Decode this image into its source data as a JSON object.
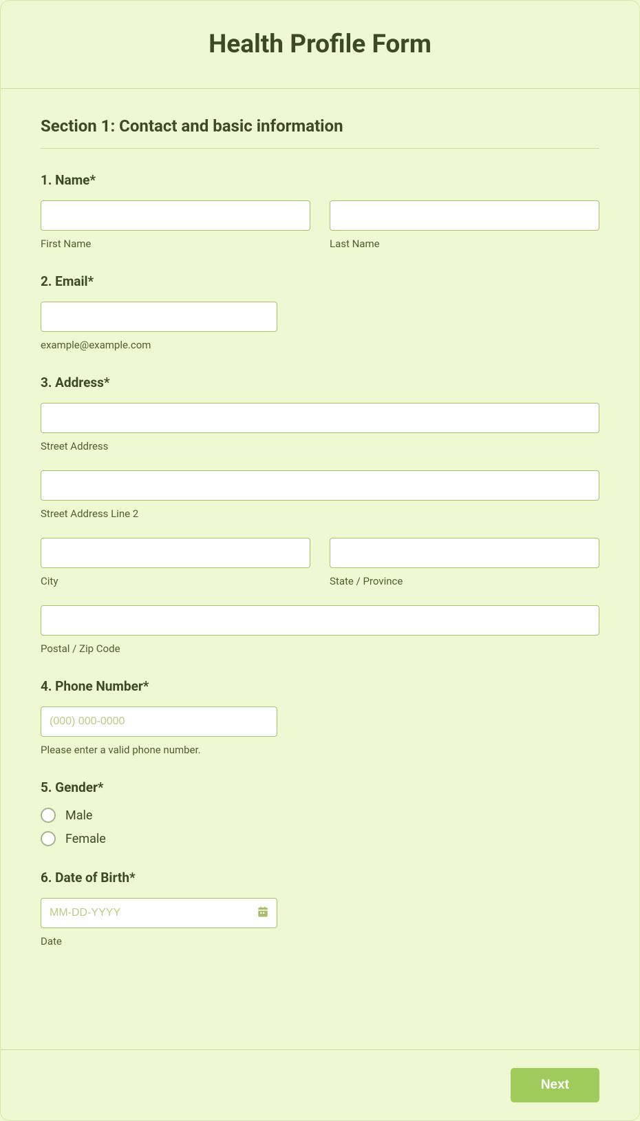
{
  "header": {
    "title": "Health Profile Form"
  },
  "section": {
    "title": "Section 1: Contact and basic information"
  },
  "q1": {
    "label": "1. Name*",
    "first_sub": "First Name",
    "last_sub": "Last Name"
  },
  "q2": {
    "label": "2. Email*",
    "sub": "example@example.com"
  },
  "q3": {
    "label": "3. Address*",
    "street_sub": "Street Address",
    "street2_sub": "Street Address Line 2",
    "city_sub": "City",
    "state_sub": "State / Province",
    "postal_sub": "Postal / Zip Code"
  },
  "q4": {
    "label": "4. Phone Number*",
    "placeholder": "(000) 000-0000",
    "sub": "Please enter a valid phone number."
  },
  "q5": {
    "label": "5. Gender*",
    "opt1": "Male",
    "opt2": "Female"
  },
  "q6": {
    "label": "6. Date of Birth*",
    "placeholder": "MM-DD-YYYY",
    "sub": "Date"
  },
  "footer": {
    "next": "Next"
  }
}
